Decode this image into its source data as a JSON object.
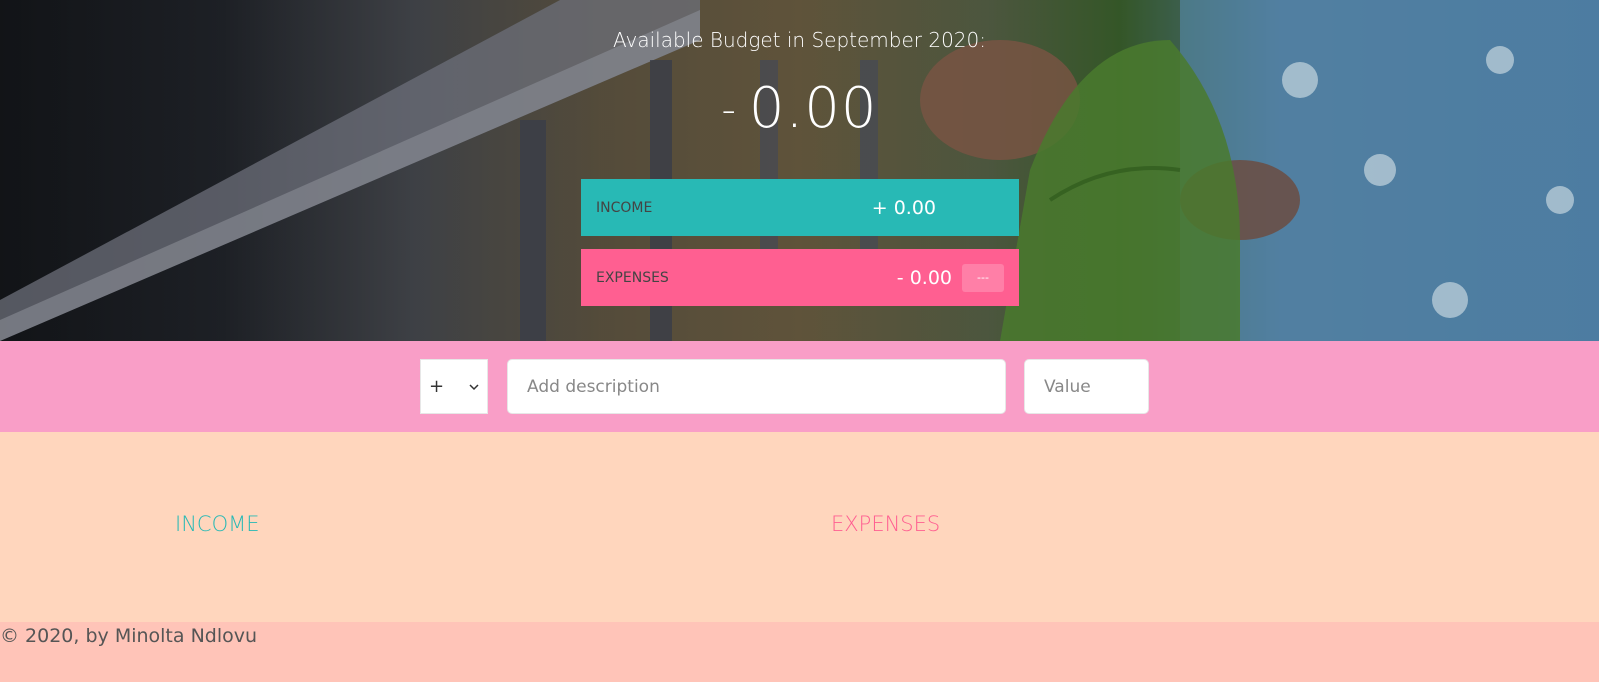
{
  "budget": {
    "title": "Available Budget in September 2020:",
    "value_sign": "-",
    "value": "0.00"
  },
  "summary": {
    "income": {
      "label": "INCOME",
      "value": "+ 0.00"
    },
    "expenses": {
      "label": "EXPENSES",
      "value": "- 0.00",
      "percentage": "---"
    }
  },
  "add": {
    "type_selected": "+",
    "description_placeholder": "Add description",
    "value_placeholder": "Value"
  },
  "lists": {
    "income_title": "INCOME",
    "expenses_title": "EXPENSES"
  },
  "footer": {
    "text": "© 2020, by Minolta Ndlovu"
  },
  "colors": {
    "income": "#28b9b5",
    "expenses": "#ff5f91",
    "add_bar": "#f99ec7",
    "lists_bg": "#ffd6bd",
    "footer_bg": "#ffc4b8"
  }
}
